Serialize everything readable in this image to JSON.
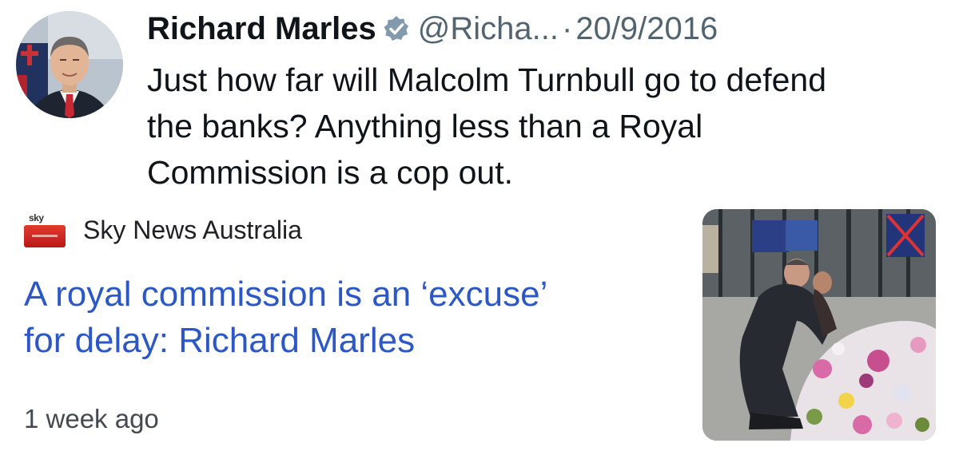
{
  "tweet": {
    "author_name": "Richard Marles",
    "handle": "@Richa...",
    "separator": "·",
    "date": "20/9/2016",
    "text_lines": [
      "Just how far will Malcolm Turnbull go to defend",
      "the banks? Anything less than a Royal",
      "Commission is a cop out."
    ],
    "avatar_icon": "profile-photo",
    "verified_icon": "verified-badge-icon"
  },
  "news_card": {
    "source_name": "Sky News Australia",
    "source_logo_text": "sky",
    "headline_lines": [
      "A royal commission is an ‘excuse’",
      "for delay: Richard Marles"
    ],
    "timestamp": "1 week ago",
    "thumbnail": "news-photo"
  },
  "colors": {
    "headline": "#2b58c6",
    "muted": "#536471",
    "verified": "#829aab"
  }
}
